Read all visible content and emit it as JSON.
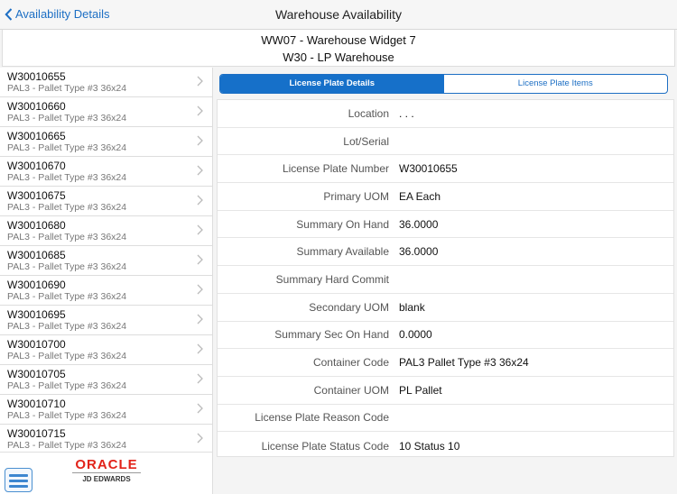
{
  "header": {
    "back_label": "Availability Details",
    "title": "Warehouse Availability"
  },
  "subheader": {
    "line1": "WW07 - Warehouse Widget 7",
    "line2": "W30 - LP Warehouse"
  },
  "list": [
    {
      "code": "W30010655",
      "desc": "PAL3 - Pallet Type #3 36x24"
    },
    {
      "code": "W30010660",
      "desc": "PAL3 - Pallet Type #3 36x24"
    },
    {
      "code": "W30010665",
      "desc": "PAL3 - Pallet Type #3 36x24"
    },
    {
      "code": "W30010670",
      "desc": "PAL3 - Pallet Type #3 36x24"
    },
    {
      "code": "W30010675",
      "desc": "PAL3 - Pallet Type #3 36x24"
    },
    {
      "code": "W30010680",
      "desc": "PAL3 - Pallet Type #3 36x24"
    },
    {
      "code": "W30010685",
      "desc": "PAL3 - Pallet Type #3 36x24"
    },
    {
      "code": "W30010690",
      "desc": "PAL3 - Pallet Type #3 36x24"
    },
    {
      "code": "W30010695",
      "desc": "PAL3 - Pallet Type #3 36x24"
    },
    {
      "code": "W30010700",
      "desc": "PAL3 - Pallet Type #3 36x24"
    },
    {
      "code": "W30010705",
      "desc": "PAL3 - Pallet Type #3 36x24"
    },
    {
      "code": "W30010710",
      "desc": "PAL3 - Pallet Type #3 36x24"
    },
    {
      "code": "W30010715",
      "desc": "PAL3 - Pallet Type #3 36x24"
    }
  ],
  "footer": {
    "logo_top": "ORACLE",
    "logo_bottom": "JD EDWARDS",
    "menu_icon": "hamburger-menu-icon"
  },
  "tabs": [
    {
      "label": "License Plate Details",
      "active": true
    },
    {
      "label": "License Plate Items",
      "active": false
    }
  ],
  "details": [
    {
      "label": "Location",
      "value": ". . ."
    },
    {
      "label": "Lot/Serial",
      "value": ""
    },
    {
      "label": "License Plate Number",
      "value": "W30010655"
    },
    {
      "label": "Primary UOM",
      "value": "EA Each"
    },
    {
      "label": "Summary On Hand",
      "value": "36.0000"
    },
    {
      "label": "Summary Available",
      "value": "36.0000"
    },
    {
      "label": "Summary Hard Commit",
      "value": ""
    },
    {
      "label": "Secondary UOM",
      "value": "blank"
    },
    {
      "label": "Summary Sec On Hand",
      "value": "0.0000"
    },
    {
      "label": "Container Code",
      "value": "PAL3 Pallet Type #3 36x24"
    },
    {
      "label": "Container UOM",
      "value": "PL Pallet"
    },
    {
      "label": "License Plate Reason Code",
      "value": ""
    },
    {
      "label": "License Plate Status Code",
      "value": "10 Status 10"
    }
  ],
  "colors": {
    "accent": "#1670c9",
    "brand_red": "#e2231a"
  }
}
